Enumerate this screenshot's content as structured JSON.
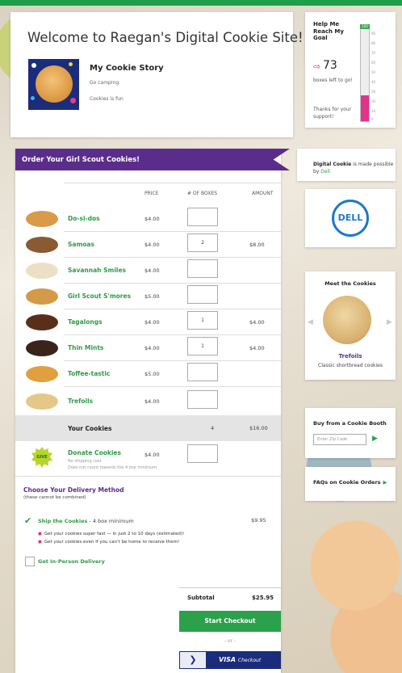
{
  "header": {
    "welcome": "Welcome to Raegan's Digital Cookie Site!",
    "story_title": "My Cookie Story",
    "story_lines": [
      "Go camping.",
      "Cookies is fun"
    ]
  },
  "goal": {
    "title": "Help Me Reach My Goal",
    "arrow": "⇨",
    "boxes_left": "73",
    "boxes_left_label": "boxes left to go!",
    "thanks": "Thanks for your support!",
    "meter_cap": "100",
    "ticks": [
      "90",
      "80",
      "70",
      "60",
      "50",
      "40",
      "30",
      "20",
      "10",
      "0"
    ],
    "progress_fraction": 0.27,
    "fill_color": "#e0338a"
  },
  "order": {
    "title": "Order Your Girl Scout Cookies!",
    "headers": {
      "price": "PRICE",
      "boxes": "# OF BOXES",
      "amount": "AMOUNT"
    },
    "cookies": [
      {
        "name": "Do-si-dos",
        "price": "$4.00",
        "qty": "",
        "amount": "",
        "color": "#d99a4a"
      },
      {
        "name": "Samoas",
        "price": "$4.00",
        "qty": "2",
        "amount": "$8.00",
        "color": "#8a5a32"
      },
      {
        "name": "Savannah Smiles",
        "price": "$4.00",
        "qty": "",
        "amount": "",
        "color": "#ece0c4"
      },
      {
        "name": "Girl Scout S'mores",
        "price": "$5.00",
        "qty": "",
        "amount": "",
        "color": "#d39a48"
      },
      {
        "name": "Tagalongs",
        "price": "$4.00",
        "qty": "1",
        "amount": "$4.00",
        "color": "#5a2f1a"
      },
      {
        "name": "Thin Mints",
        "price": "$4.00",
        "qty": "1",
        "amount": "$4.00",
        "color": "#3a241a"
      },
      {
        "name": "Toffee-tastic",
        "price": "$5.00",
        "qty": "",
        "amount": "",
        "color": "#e0a040"
      },
      {
        "name": "Trefoils",
        "price": "$4.00",
        "qty": "",
        "amount": "",
        "color": "#e6c78a"
      }
    ],
    "total_label": "Your Cookies",
    "total_count": "4",
    "total_amount": "$16.00",
    "donate": {
      "badge": "GIVE",
      "name": "Donate Cookies",
      "price": "$4.00",
      "note1": "No shipping cost",
      "note2": "Does not count towards the 4 box minimum"
    },
    "delivery": {
      "title": "Choose Your Delivery Method",
      "subtitle": "(these cannot be combined)",
      "ship_label": "Ship the Cookies",
      "ship_min": " - 4 box minimum",
      "ship_price": "$9.95",
      "bullets": [
        "Get your cookies super fast — in just 2 to 10 days (estimated)!",
        "Get your cookies even if you can't be home to receive them!"
      ],
      "inperson_label": "Get In-Person Delivery"
    },
    "subtotal_label": "Subtotal",
    "subtotal_amount": "$25.95",
    "checkout_label": "Start Checkout",
    "or_label": "- or -",
    "visa_label": "VISA",
    "visa_sub": "Checkout"
  },
  "sidebar": {
    "digital_cookie_bold": "Digital Cookie",
    "digital_cookie_text": " is made possible by ",
    "dell_link": "Dell",
    "dell_logo": "DELL",
    "meet_title": "Meet the Cookies",
    "meet_cookie": "Trefoils",
    "meet_desc": "Classic shortbread cookies",
    "booth_title": "Buy from a Cookie Booth",
    "zip_placeholder": "Enter Zip Code",
    "faq_label": "FAQs on Cookie Orders"
  }
}
